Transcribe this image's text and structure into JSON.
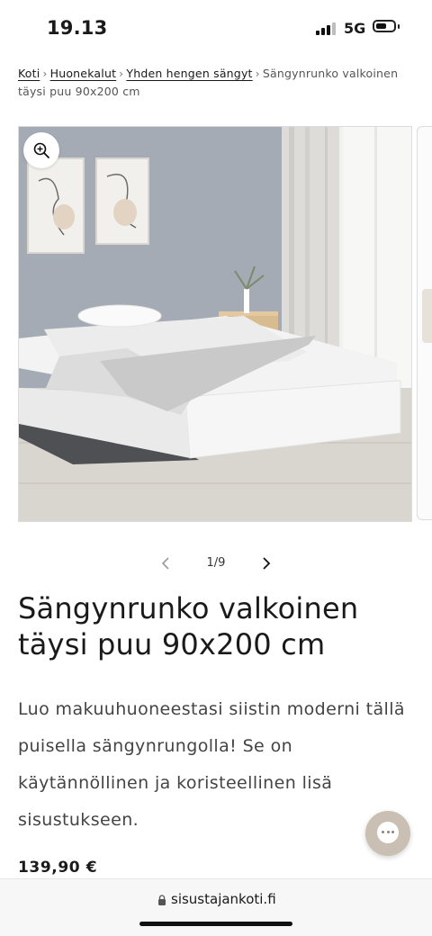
{
  "status_bar": {
    "time": "19.13",
    "network": "5G"
  },
  "breadcrumb": {
    "items": [
      "Koti",
      "Huonekalut",
      "Yhden hengen sängyt"
    ],
    "current": "Sängynrunko valkoinen täysi puu 90x200 cm",
    "separator": "›"
  },
  "gallery": {
    "counter": "1/9",
    "current_index": 1,
    "total": 9
  },
  "product": {
    "title": "Sängynrunko valkoinen täysi puu 90x200 cm",
    "description": "Luo makuuhuoneestasi siistin moderni tällä puisella sängynrungolla! Se on käytännöllinen ja koristeellinen lisä sisustukseen.",
    "price": "139,90 €"
  },
  "browser": {
    "domain": "sisustajankoti.fi"
  },
  "icons": {
    "zoom": "zoom-in-icon",
    "prev": "chevron-left-icon",
    "next": "chevron-right-icon",
    "chat": "chat-icon",
    "lock": "lock-icon"
  },
  "colors": {
    "chat_button": "#c9bfb2",
    "text": "#1a1a1a"
  }
}
